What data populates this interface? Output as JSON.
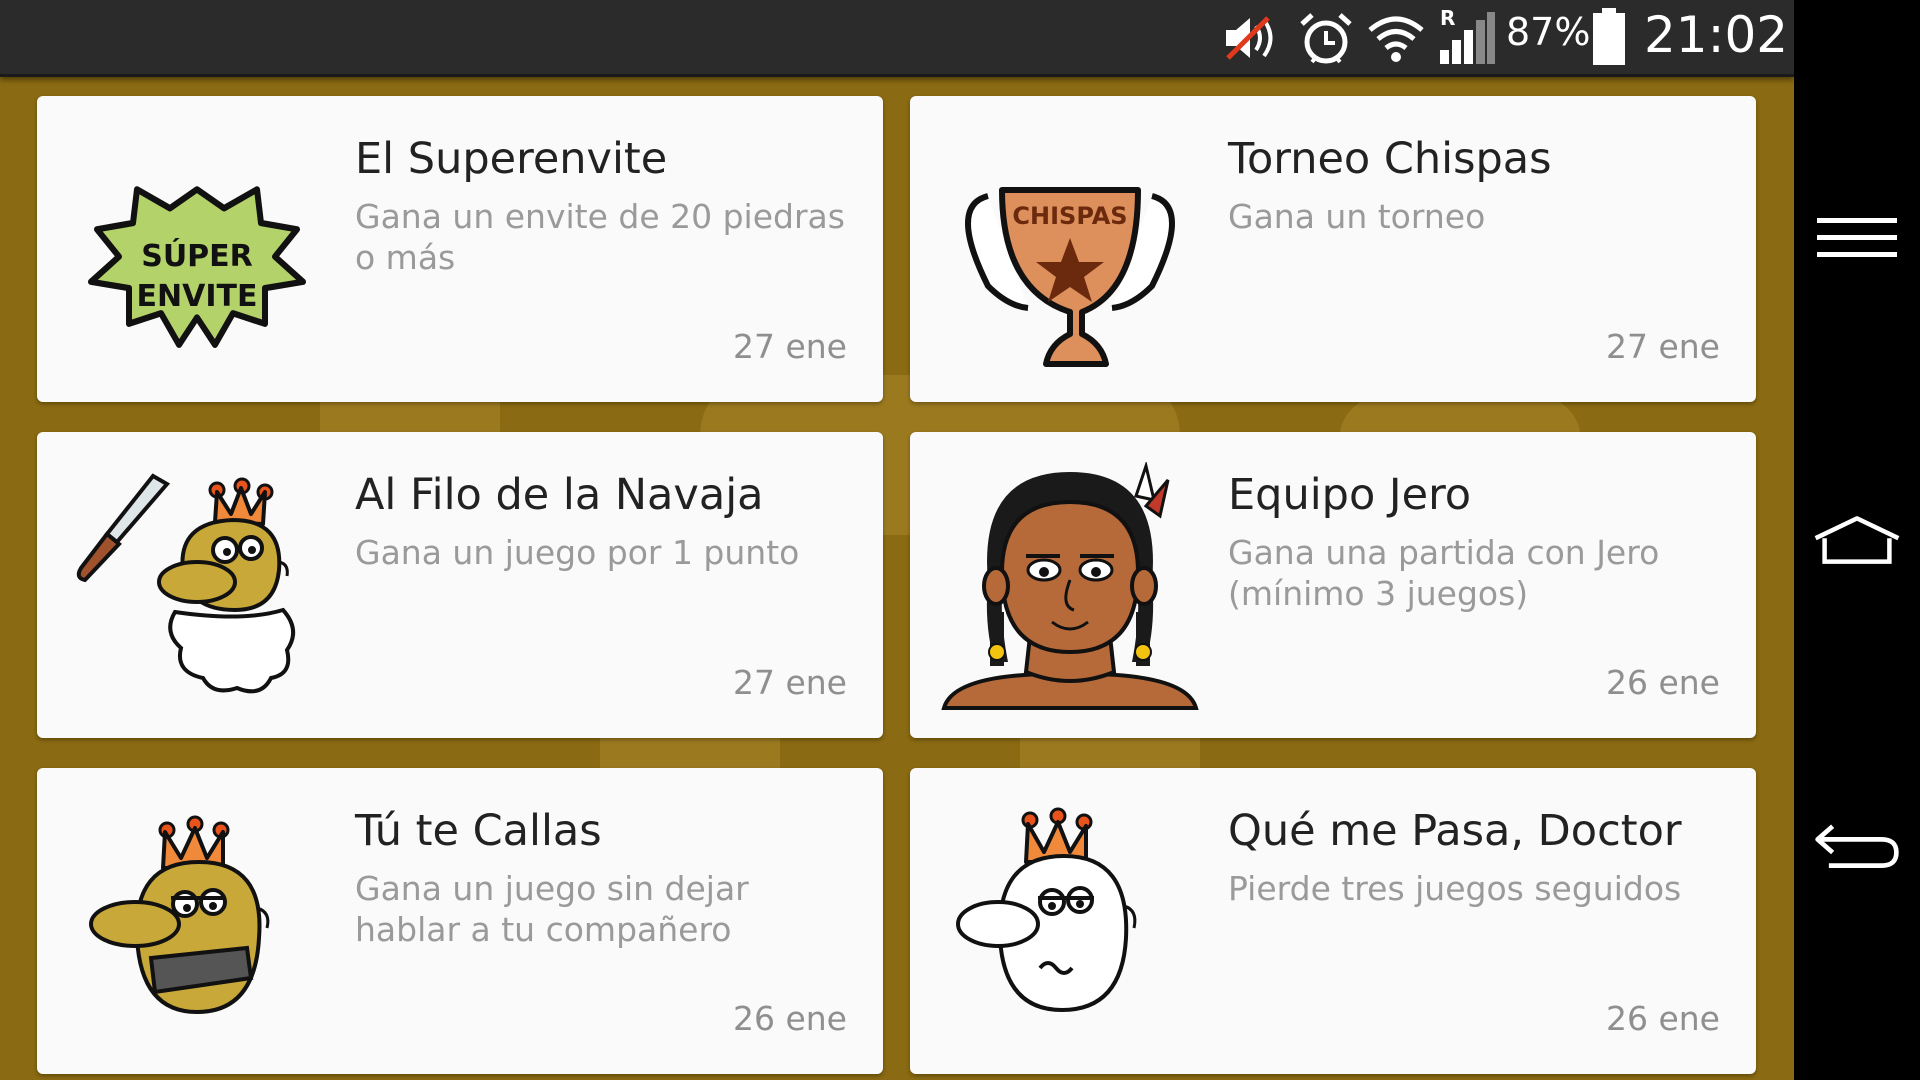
{
  "status_bar": {
    "battery_percent": "87%",
    "time": "21:02",
    "roaming_indicator": "R",
    "icons": [
      "volume-muted-icon",
      "alarm-icon",
      "wifi-icon",
      "signal-icon",
      "battery-icon"
    ]
  },
  "nav_bar": {
    "icons": [
      "menu-icon",
      "home-icon",
      "back-icon"
    ]
  },
  "colors": {
    "background": "#8a6a12",
    "card": "#fafafa",
    "title": "#222222",
    "subtitle": "#9a9a9a",
    "status_bar": "#2b2b2b"
  },
  "achievements": [
    {
      "title": "El Superenvite",
      "description": "Gana un envite de 20 piedras o más",
      "date": "27 ene",
      "art_text": [
        "SÚPER",
        "ENVITE"
      ],
      "icon": "super-envite-badge-icon"
    },
    {
      "title": "Torneo Chispas",
      "description": "Gana un torneo",
      "date": "27 ene",
      "art_text": [
        "CHISPAS"
      ],
      "icon": "trophy-icon"
    },
    {
      "title": "Al Filo de la Navaja",
      "description": "Gana un juego por 1 punto",
      "date": "27 ene",
      "icon": "king-with-knife-icon"
    },
    {
      "title": "Equipo Jero",
      "description": "Gana una partida con Jero (mínimo 3 juegos)",
      "date": "26 ene",
      "icon": "jero-character-icon"
    },
    {
      "title": "Tú te Callas",
      "description": "Gana un juego sin dejar hablar a tu compañero",
      "date": "26 ene",
      "icon": "gagged-king-icon"
    },
    {
      "title": "Qué me Pasa, Doctor",
      "description": "Pierde tres juegos seguidos",
      "date": "26 ene",
      "icon": "sick-king-icon"
    }
  ]
}
